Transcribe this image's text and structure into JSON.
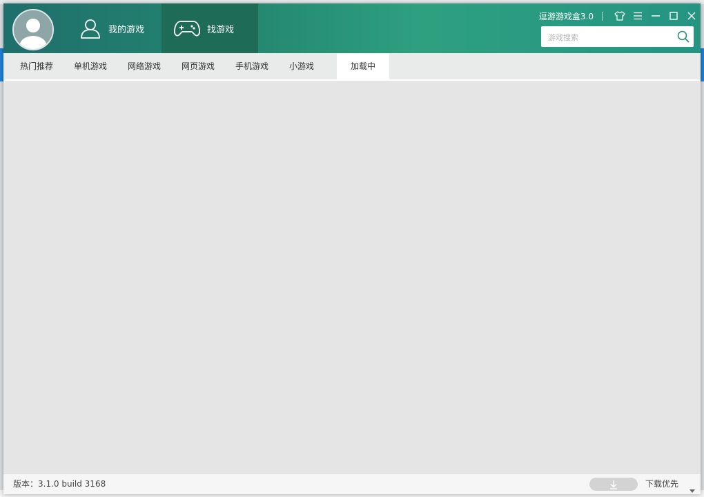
{
  "app": {
    "title": "逗游游戏盒3.0"
  },
  "nav": {
    "my_games": "我的游戏",
    "find_games": "找游戏"
  },
  "search": {
    "placeholder": "游戏搜索"
  },
  "categories": [
    {
      "label": "热门推荐",
      "active": false
    },
    {
      "label": "单机游戏",
      "active": false
    },
    {
      "label": "网络游戏",
      "active": false
    },
    {
      "label": "网页游戏",
      "active": false
    },
    {
      "label": "手机游戏",
      "active": false
    },
    {
      "label": "小游戏",
      "active": false
    },
    {
      "label": "加载中",
      "active": true
    }
  ],
  "status": {
    "version": "版本：3.1.0 build 3168",
    "download_pref": "下载优先"
  },
  "icons": {
    "avatar": "user-avatar",
    "my_games": "user-icon",
    "find_games": "gamepad-icon",
    "skin": "tshirt-icon",
    "menu": "menu-icon",
    "minimize": "minimize-icon",
    "maximize": "maximize-icon",
    "close": "close-icon",
    "search": "search-icon",
    "download": "download-icon",
    "dropdown": "caret-down-icon"
  },
  "colors": {
    "header_start": "#1f6f6c",
    "header_end": "#259482",
    "active_tab": "#1e6b58",
    "content_bg": "#e5e5e5"
  }
}
